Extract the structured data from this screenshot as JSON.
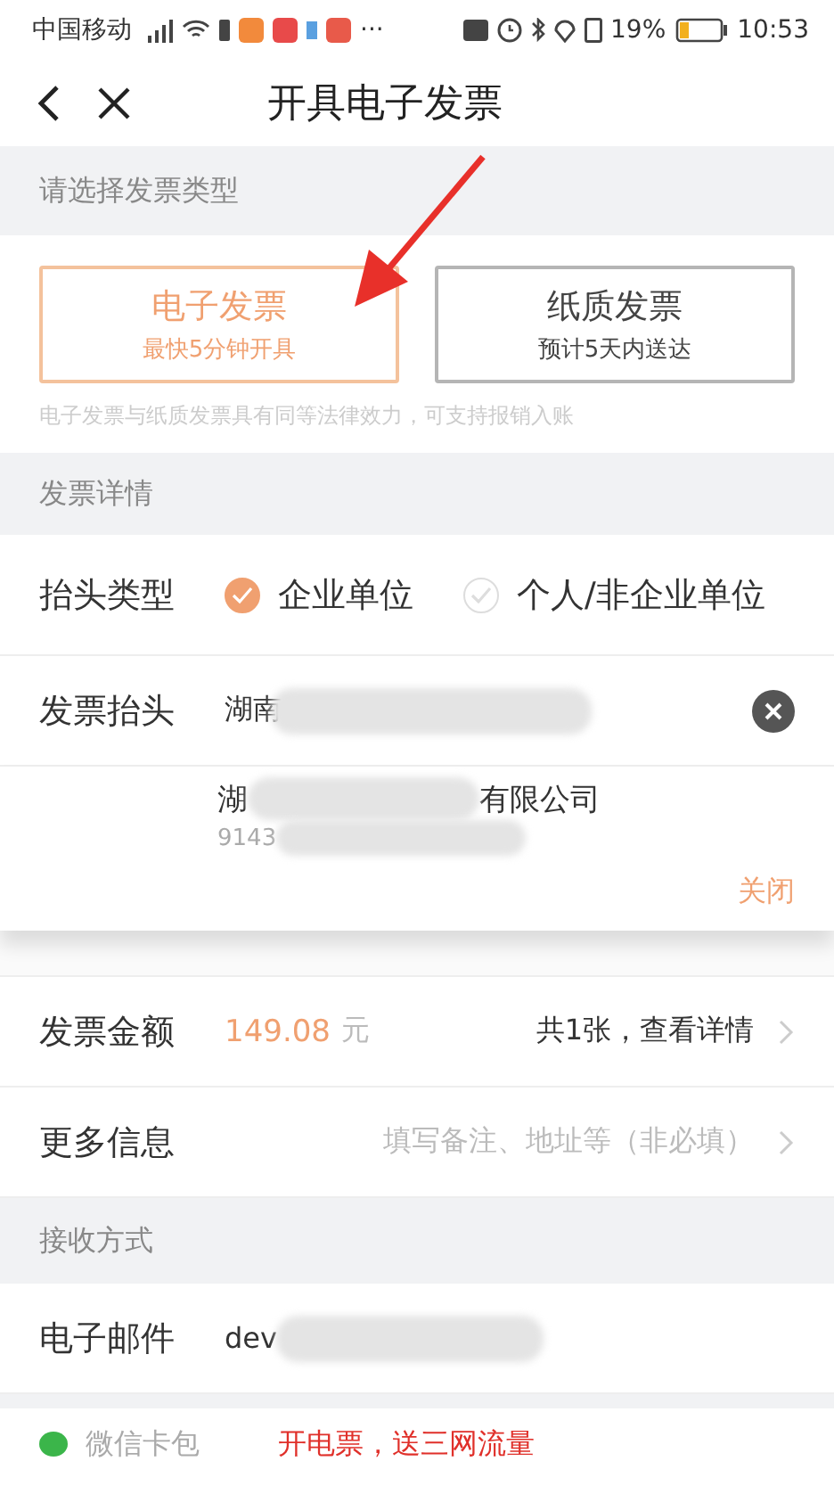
{
  "status_bar": {
    "carrier": "中国移动",
    "more": "···",
    "battery_text": "19%",
    "time": "10:53"
  },
  "nav": {
    "title": "开具电子发票"
  },
  "type_section": {
    "header": "请选择发票类型",
    "options": [
      {
        "title": "电子发票",
        "subtitle": "最快5分钟开具",
        "selected": true
      },
      {
        "title": "纸质发票",
        "subtitle": "预计5天内送达",
        "selected": false
      }
    ],
    "note": "电子发票与纸质发票具有同等法律效力，可支持报销入账"
  },
  "details_section": {
    "header": "发票详情",
    "title_type": {
      "label": "抬头类型",
      "options": [
        {
          "label": "企业单位",
          "selected": true
        },
        {
          "label": "个人/非企业单位",
          "selected": false
        }
      ]
    },
    "invoice_title": {
      "label": "发票抬头",
      "value": "湖南"
    },
    "suggestion": {
      "name_start": "湖",
      "name_end": "有限公司",
      "tax_id": "9143",
      "close": "关闭"
    },
    "amount": {
      "label": "发票金额",
      "value": "149.08",
      "unit": "元",
      "summary": "共1张，查看详情"
    },
    "more_info": {
      "label": "更多信息",
      "placeholder": "填写备注、地址等（非必填）"
    }
  },
  "receive_section": {
    "header": "接收方式",
    "email": {
      "label": "电子邮件",
      "value": "dev"
    }
  },
  "wallet_bar": {
    "label": "微信卡包",
    "promo": "开电票，送三网流量"
  }
}
